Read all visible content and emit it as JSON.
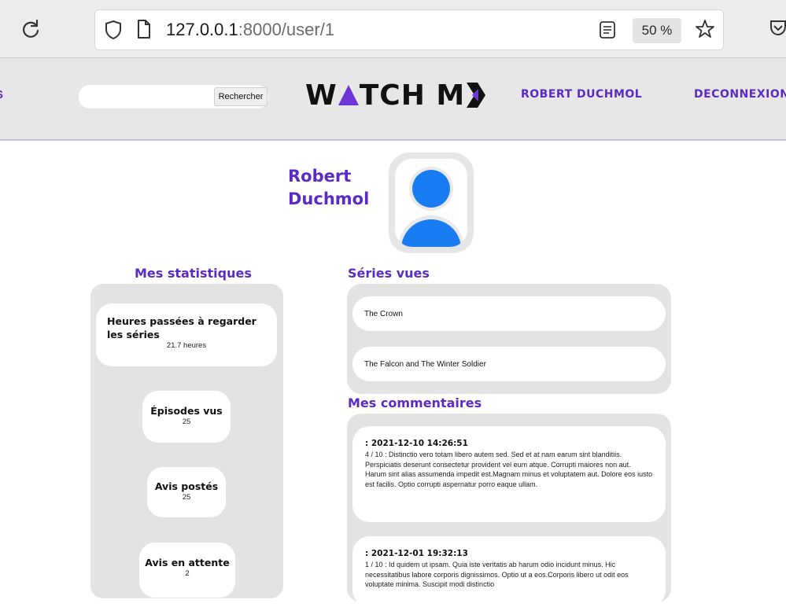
{
  "browser": {
    "url_host": "127.0.0.1",
    "url_rest": ":8000/user/1",
    "zoom": "50 %"
  },
  "header": {
    "left_fragment": "S",
    "search_placeholder": "",
    "search_button": "Rechercher",
    "logo_left": "W",
    "logo_mid": "TCH M",
    "user_link": "ROBERT DUCHMOL",
    "logout_link": "DECONNEXION"
  },
  "profile": {
    "first_name": "Robert",
    "last_name": "Duchmol"
  },
  "stats": {
    "title": "Mes statistiques",
    "items": [
      {
        "label": "Heures passées à regarder les séries",
        "value": "21.7 heures"
      },
      {
        "label": "Épisodes vus",
        "value": "25"
      },
      {
        "label": "Avis postés",
        "value": "25"
      },
      {
        "label": "Avis en attente",
        "value": "2"
      }
    ]
  },
  "series": {
    "title": "Séries vues",
    "items": [
      "The Crown",
      "The Falcon and The Winter Soldier"
    ]
  },
  "comments": {
    "title": "Mes commentaires",
    "items": [
      {
        "date": ": 2021-12-10 14:26:51",
        "text": "4 / 10 : Distinctio vero totam libero autem sed. Sed et at nam earum sint blanditiis. Perspiciatis deserunt consectetur provident vel eum atque. Corrupti maiores non aut. Harum sint alias assumenda impedit est.Magnam minus et voluptatem aut. Dolore eos iusto est facilis. Optio corrupti aspernatur porro eaque ullam."
      },
      {
        "date": ": 2021-12-01 19:32:13",
        "text": "1 / 10 : Id quidem ut ipsam. Quia iste veritatis ab harum odio incidunt minus. Hic necessitatibus labore corporis dignissimos. Optio ut a eos.Corporis libero ut odit eos voluptate minima. Suscipit modi distinctio"
      }
    ]
  },
  "colors": {
    "accent": "#5b2bc4",
    "avatar": "#1a7cf2"
  }
}
